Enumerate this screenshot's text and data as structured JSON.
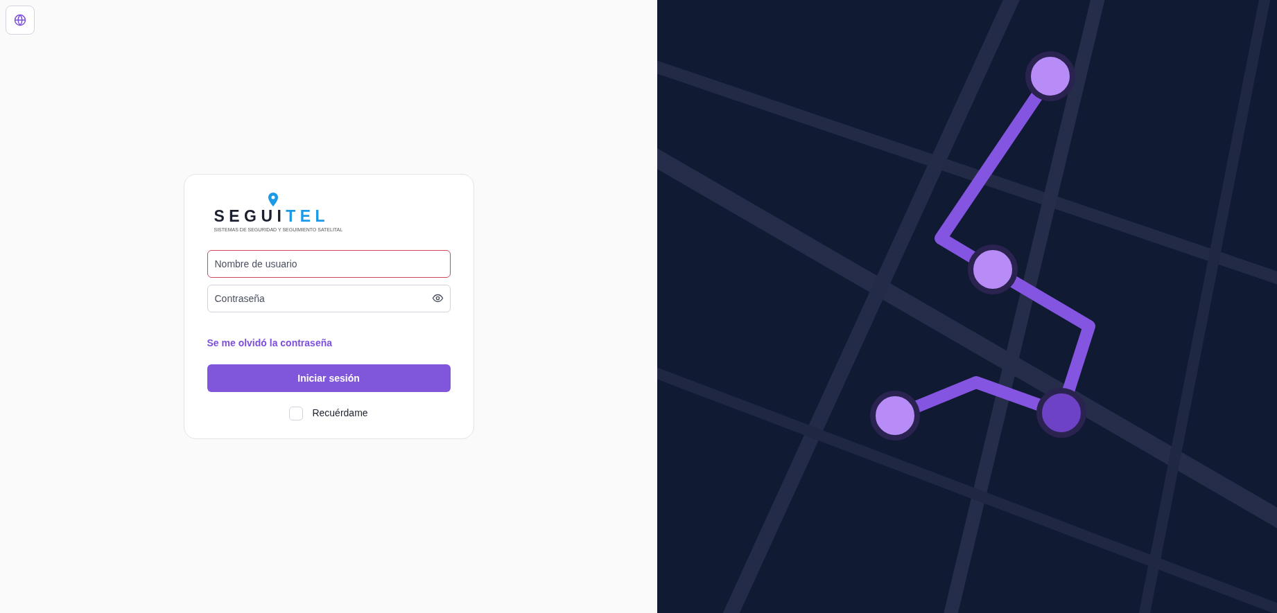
{
  "logo": {
    "name_dark": "SEGUI",
    "name_accent": "TEL",
    "tagline": "SISTEMAS DE SEGURIDAD Y SEGUIMIENTO SATELITAL"
  },
  "form": {
    "username": {
      "placeholder": "Nombre de usuario",
      "invalid": true
    },
    "password": {
      "placeholder": "Contraseña"
    },
    "forgot_link": "Se me olvidó la contraseña",
    "submit": "Iniciar sesión",
    "remember": {
      "label": "Recuérdame",
      "checked": false
    }
  }
}
